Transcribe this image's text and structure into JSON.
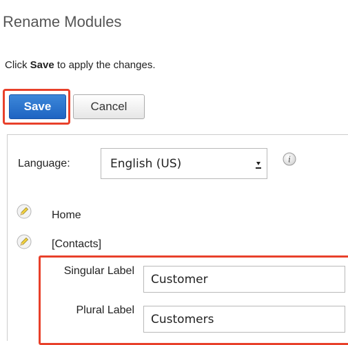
{
  "page": {
    "title": "Rename Modules",
    "instruction_prefix": "Click ",
    "instruction_bold": "Save",
    "instruction_suffix": " to apply the changes."
  },
  "buttons": {
    "save_label": "Save",
    "cancel_label": "Cancel"
  },
  "language": {
    "label": "Language:",
    "selected": "English (US)"
  },
  "modules": [
    {
      "label": "Home"
    },
    {
      "label": "[Contacts]"
    }
  ],
  "fields": {
    "singular_label": "Singular Label",
    "singular_value": "Customer",
    "plural_label": "Plural Label",
    "plural_value": "Customers"
  },
  "colors": {
    "highlight": "#e8402a",
    "save_button": "#2b74cf"
  },
  "icons": {
    "info": "info-icon",
    "edit": "pencil-icon",
    "dropdown": "dropdown-arrow-icon"
  }
}
